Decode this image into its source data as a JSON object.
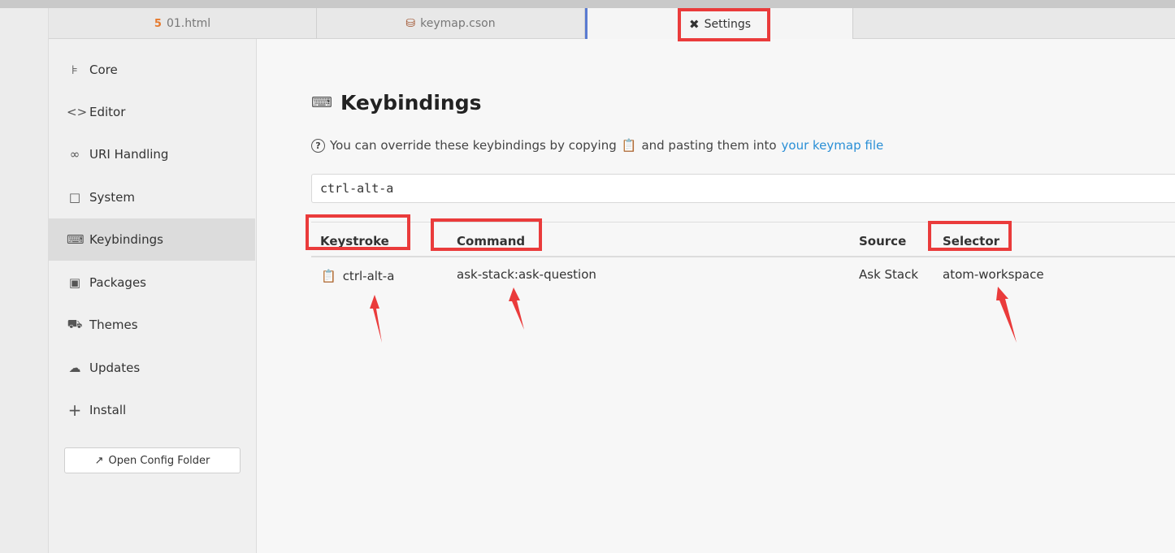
{
  "tabs": [
    {
      "label": "01.html",
      "icon": "html5-icon",
      "active": false
    },
    {
      "label": "keymap.cson",
      "icon": "database-icon",
      "active": false
    },
    {
      "label": "Settings",
      "icon": "tools-icon",
      "active": true
    }
  ],
  "sidebar": {
    "items": [
      {
        "label": "Core",
        "icon": "sliders-icon"
      },
      {
        "label": "Editor",
        "icon": "code-icon"
      },
      {
        "label": "URI Handling",
        "icon": "link-icon"
      },
      {
        "label": "System",
        "icon": "monitor-icon"
      },
      {
        "label": "Keybindings",
        "icon": "keyboard-icon",
        "active": true
      },
      {
        "label": "Packages",
        "icon": "package-icon"
      },
      {
        "label": "Themes",
        "icon": "paintcan-icon"
      },
      {
        "label": "Updates",
        "icon": "cloud-download-icon"
      },
      {
        "label": "Install",
        "icon": "plus-icon"
      }
    ],
    "config_button": "Open Config Folder"
  },
  "main": {
    "heading": "Keybindings",
    "info_before": "You can override these keybindings by copying",
    "info_middle": "and pasting them into",
    "info_link": "your keymap file",
    "search_value": "ctrl-alt-a"
  },
  "table": {
    "headers": {
      "keystroke": "Keystroke",
      "command": "Command",
      "source": "Source",
      "selector": "Selector"
    },
    "rows": [
      {
        "keystroke": "ctrl-alt-a",
        "command": "ask-stack:ask-question",
        "source": "Ask Stack",
        "selector": "atom-workspace"
      }
    ]
  },
  "colors": {
    "annotation": "#ea3b3b",
    "link": "#2a8fd6",
    "active_tab_border": "#5a7bd1"
  }
}
